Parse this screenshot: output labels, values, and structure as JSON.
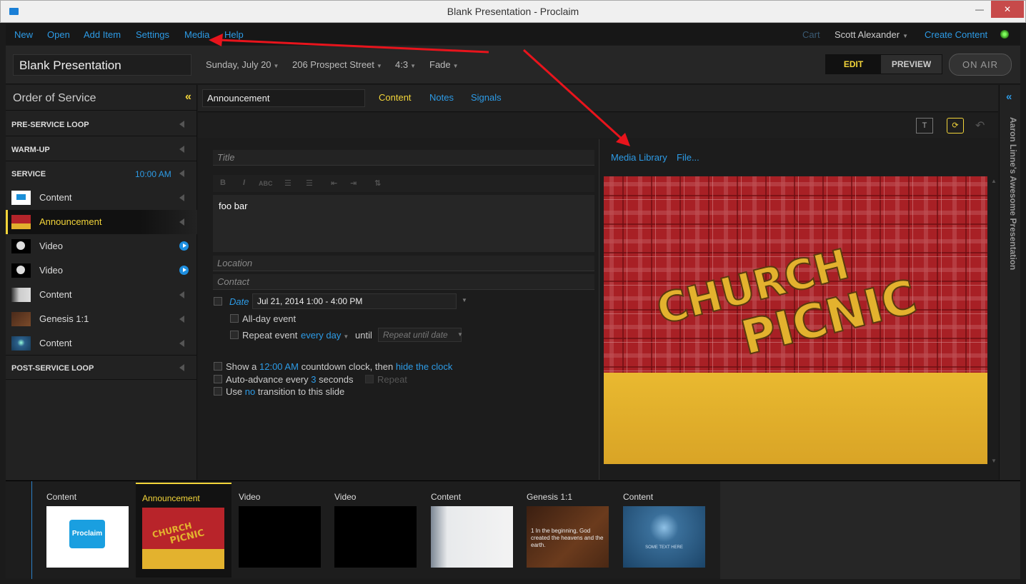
{
  "window": {
    "title": "Blank Presentation - Proclaim",
    "min": "—",
    "max": "▢",
    "close": "✕"
  },
  "menu": {
    "items": [
      "New",
      "Open",
      "Add Item",
      "Settings",
      "Media",
      "Help"
    ],
    "cart": "Cart",
    "user": "Scott Alexander",
    "create": "Create Content"
  },
  "header": {
    "title": "Blank Presentation",
    "date": "Sunday, July 20",
    "location": "206 Prospect Street",
    "ratio": "4:3",
    "transition": "Fade",
    "edit": "EDIT",
    "preview": "PREVIEW",
    "on_air": "ON AIR"
  },
  "sidebar": {
    "title": "Order of Service",
    "collapse": "«",
    "sections": {
      "pre": "PRE-SERVICE LOOP",
      "warm": "WARM-UP",
      "service": "SERVICE",
      "service_time": "10:00 AM",
      "post": "POST-SERVICE LOOP"
    },
    "items": [
      {
        "label": "Content"
      },
      {
        "label": "Announcement"
      },
      {
        "label": "Video"
      },
      {
        "label": "Video"
      },
      {
        "label": "Content"
      },
      {
        "label": "Genesis 1:1"
      },
      {
        "label": "Content"
      }
    ]
  },
  "editor": {
    "slide_name": "Announcement",
    "tabs": [
      "Content",
      "Notes",
      "Signals"
    ],
    "title_label": "Title",
    "fmt": [
      "B",
      "I",
      "ABC"
    ],
    "body": "foo bar",
    "location_label": "Location",
    "contact_label": "Contact",
    "date_label": "Date",
    "date_value": "Jul 21, 2014 1:00 - 4:00 PM",
    "allday": "All-day event",
    "repeat_event": "Repeat event",
    "every_day": "every day",
    "until": "until",
    "repeat_until": "Repeat until date",
    "countdown_a": "Show a",
    "countdown_time": "12:00 AM",
    "countdown_b": "countdown clock, then",
    "countdown_c": "hide the clock",
    "advance_a": "Auto-advance every",
    "advance_n": "3",
    "advance_b": "seconds",
    "repeat": "Repeat",
    "trans_a": "Use",
    "trans_b": "no",
    "trans_c": "transition to this slide"
  },
  "media": {
    "library": "Media Library",
    "file": "File...",
    "art_line1": "CHURCH",
    "art_line2": "PICNIC"
  },
  "rightbar": {
    "collapse": "«",
    "title": "Aaron Linne's Awesome Presentation"
  },
  "strip": {
    "cards": [
      {
        "label": "Content"
      },
      {
        "label": "Announcement"
      },
      {
        "label": "Video"
      },
      {
        "label": "Video"
      },
      {
        "label": "Content"
      },
      {
        "label": "Genesis 1:1"
      },
      {
        "label": "Content"
      }
    ],
    "proclaim_logo": "Proclaim",
    "genesis_text": "1 In the beginning, God created the heavens and the earth.",
    "some_text": "SOME TEXT HERE"
  },
  "colors": {
    "accent": "#2d9be6",
    "active": "#f3d53a",
    "annotation": "#e8141c"
  }
}
